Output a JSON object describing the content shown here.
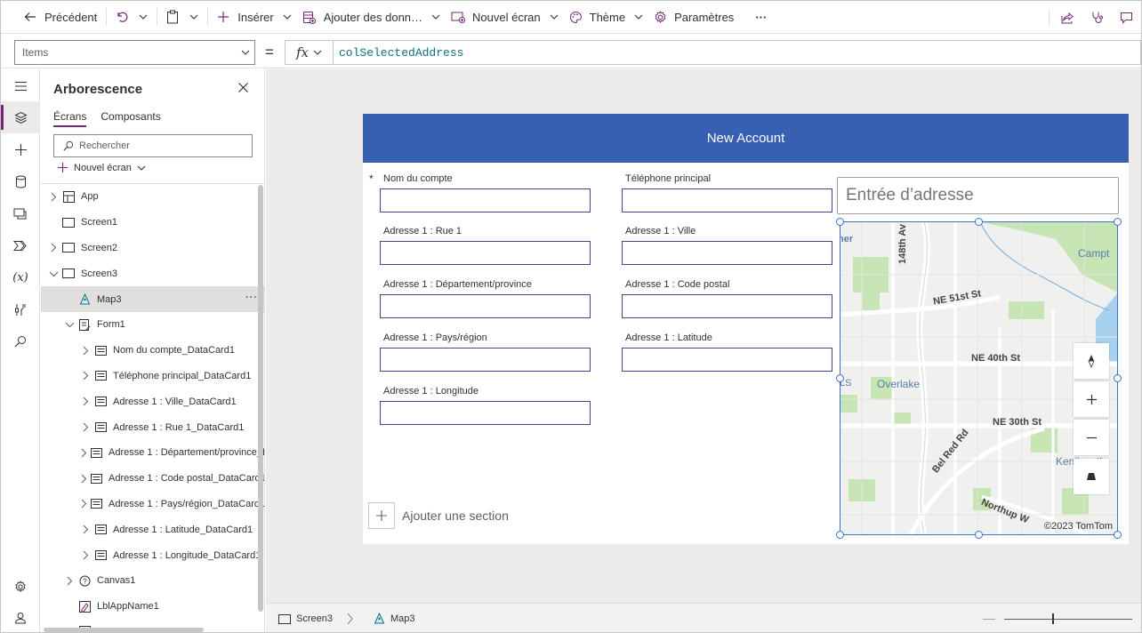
{
  "toolbar": {
    "back_label": "Précédent",
    "insert_label": "Insérer",
    "add_data_label": "Ajouter des donn…",
    "new_screen_label": "Nouvel écran",
    "theme_label": "Thème",
    "settings_label": "Paramètres",
    "more_label": "···"
  },
  "formula_bar": {
    "property": "Items",
    "equals": "=",
    "fx_label": "fx",
    "formula": "colSelectedAddress"
  },
  "tree_panel": {
    "title": "Arborescence",
    "tabs": [
      {
        "label": "Écrans",
        "active": true
      },
      {
        "label": "Composants",
        "active": false
      }
    ],
    "search_placeholder": "Rechercher",
    "new_screen_label": "Nouvel écran",
    "nodes": [
      {
        "label": "App",
        "level": 0,
        "caret": "right",
        "icon": "app-icon"
      },
      {
        "label": "Screen1",
        "level": 0,
        "caret": "none",
        "icon": "screen-icon"
      },
      {
        "label": "Screen2",
        "level": 0,
        "caret": "right",
        "icon": "screen-icon"
      },
      {
        "label": "Screen3",
        "level": 0,
        "caret": "down",
        "icon": "screen-icon"
      },
      {
        "label": "Map3",
        "level": 1,
        "caret": "none",
        "icon": "map-icon",
        "selected": true
      },
      {
        "label": "Form1",
        "level": 1,
        "caret": "down",
        "icon": "form-icon"
      },
      {
        "label": "Nom du compte_DataCard1",
        "level": 2,
        "caret": "right",
        "icon": "card-icon"
      },
      {
        "label": "Téléphone principal_DataCard1",
        "level": 2,
        "caret": "right",
        "icon": "card-icon"
      },
      {
        "label": "Adresse 1 : Ville_DataCard1",
        "level": 2,
        "caret": "right",
        "icon": "card-icon"
      },
      {
        "label": "Adresse 1 : Rue 1_DataCard1",
        "level": 2,
        "caret": "right",
        "icon": "card-icon"
      },
      {
        "label": "Adresse 1 : Département/province_D",
        "level": 2,
        "caret": "right",
        "icon": "card-icon"
      },
      {
        "label": "Adresse 1 : Code postal_DataCard1",
        "level": 2,
        "caret": "right",
        "icon": "card-icon"
      },
      {
        "label": "Adresse 1 : Pays/région_DataCard1",
        "level": 2,
        "caret": "right",
        "icon": "card-icon"
      },
      {
        "label": "Adresse 1 : Latitude_DataCard1",
        "level": 2,
        "caret": "right",
        "icon": "card-icon"
      },
      {
        "label": "Adresse 1 : Longitude_DataCard1",
        "level": 2,
        "caret": "right",
        "icon": "card-icon"
      },
      {
        "label": "Canvas1",
        "level": 1,
        "caret": "right",
        "icon": "canvas-icon"
      },
      {
        "label": "LblAppName1",
        "level": 1,
        "caret": "none",
        "icon": "label-icon"
      },
      {
        "label": "RectQuickActionBar1",
        "level": 1,
        "caret": "none",
        "icon": "rect-icon"
      }
    ]
  },
  "app_screen": {
    "header_title": "New Account",
    "required_marker": "*",
    "fields": {
      "account_name": "Nom du compte",
      "main_phone": "Téléphone principal",
      "street1": "Adresse 1 : Rue 1",
      "city": "Adresse 1 : Ville",
      "state": "Adresse 1 : Département/province",
      "postal_code": "Adresse 1 : Code postal",
      "country": "Adresse 1 : Pays/région",
      "latitude": "Adresse 1 : Latitude",
      "longitude": "Adresse 1 : Longitude"
    },
    "add_section_label": "Ajouter une section",
    "address_input_placeholder": "Entrée d’adresse",
    "map": {
      "labels": {
        "street_148": "148th Av",
        "ne51": "NE 51st St",
        "ne40": "NE 40th St",
        "ne30": "NE 30th St",
        "overlake": "Overlake",
        "belred": "Bel Red Rd",
        "campus": "Campt",
        "kenilworth": "Kenilworth",
        "northup": "Northup W",
        "edge_ls": "LS",
        "edge_her": "her"
      },
      "copyright": "©2023 TomTom"
    }
  },
  "status_bar": {
    "screen_crumb": "Screen3",
    "control_crumb": "Map3",
    "zoom_minus": "—"
  },
  "colors": {
    "header_blue": "#3860b2",
    "accent_purple": "#742774",
    "selection_blue": "#3b6fd4",
    "map_green": "#c7e5b4",
    "map_water": "#a8d1f0"
  }
}
